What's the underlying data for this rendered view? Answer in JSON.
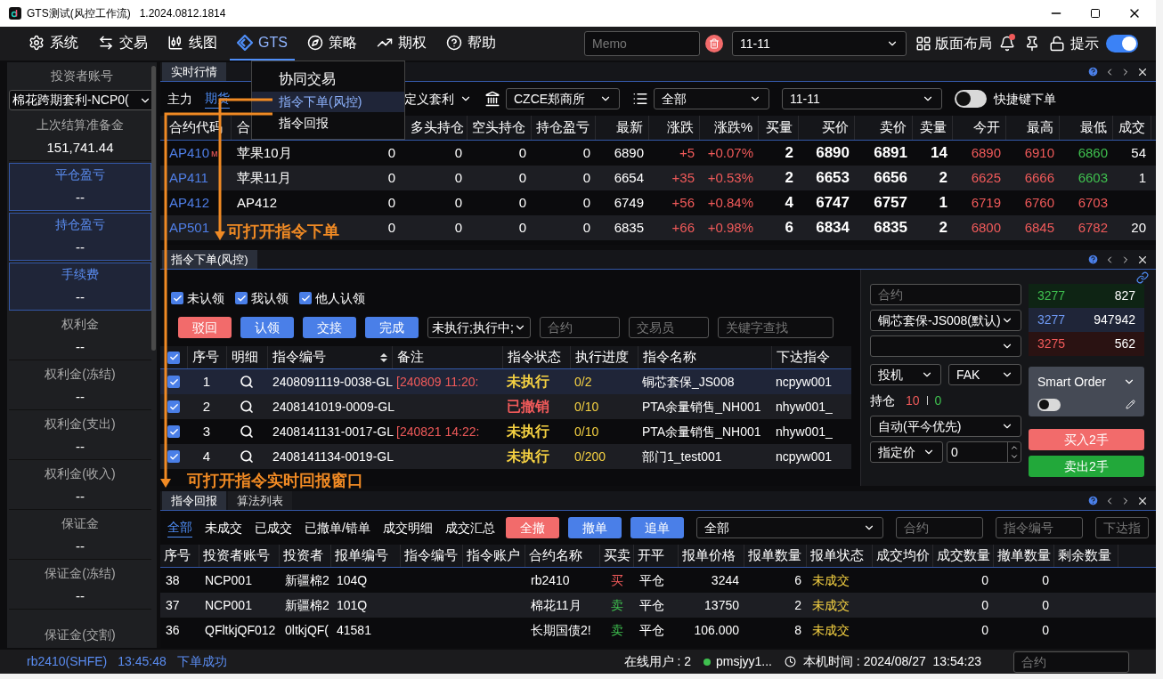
{
  "window": {
    "title": "GTS测试(风控工作流)",
    "version": "1.2024.0812.1814"
  },
  "menu": [
    {
      "label": "系统",
      "selected": false
    },
    {
      "label": "交易",
      "selected": false
    },
    {
      "label": "线图",
      "selected": false
    },
    {
      "label": "GTS",
      "selected": true
    },
    {
      "label": "策略",
      "selected": false
    },
    {
      "label": "期权",
      "selected": false
    },
    {
      "label": "帮助",
      "selected": false
    }
  ],
  "toolbar": {
    "memo_placeholder": "Memo",
    "period": "11-11",
    "layout": "版面布局",
    "hint": "提示",
    "hint_on": true
  },
  "gts_menu": [
    {
      "label": "协同交易",
      "selected": false
    },
    {
      "label": "指令下单(风控)",
      "selected": true
    },
    {
      "label": "指令回报",
      "selected": false
    }
  ],
  "annotations": [
    {
      "text": "可打开指令下单"
    },
    {
      "text": "可打开指令实时回报窗口"
    }
  ],
  "sidebar": {
    "title": "投资者账号",
    "account": "棉花跨期套利-NCP0(",
    "fields": [
      {
        "label": "上次结算准备金",
        "value": "151,741.44",
        "highlighted": false
      },
      {
        "label": "平仓盈亏",
        "value": "--",
        "highlighted": true
      },
      {
        "label": "持仓盈亏",
        "value": "--",
        "highlighted": true
      },
      {
        "label": "手续费",
        "value": "--",
        "highlighted": true
      },
      {
        "label": "权利金",
        "value": "--",
        "highlighted": false
      },
      {
        "label": "权利金(冻结)",
        "value": "--",
        "highlighted": false
      },
      {
        "label": "权利金(支出)",
        "value": "--",
        "highlighted": false
      },
      {
        "label": "权利金(收入)",
        "value": "--",
        "highlighted": false
      },
      {
        "label": "保证金",
        "value": "--",
        "highlighted": false
      },
      {
        "label": "保证金(冻结)",
        "value": "--",
        "highlighted": false
      },
      {
        "label": "保证金(交割)",
        "highlighted": false
      }
    ]
  },
  "market": {
    "tab": "实时行情",
    "filters": [
      {
        "label": "主力",
        "selected": false
      },
      {
        "label": "期货",
        "selected": true
      }
    ],
    "custom": "定义套利",
    "exchange": "CZCE郑商所",
    "category": "全部",
    "period": "11-11",
    "hotkey_label": "快捷键下单",
    "hotkey_on": false,
    "columns": [
      {
        "label": "合约代码"
      },
      {
        "label": "合"
      },
      {},
      {
        "label": "多头持仓"
      },
      {
        "label": "空头持仓"
      },
      {
        "label": "持仓盈亏"
      },
      {
        "label": "最新"
      },
      {
        "label": "涨跌"
      },
      {
        "label": "涨跌%"
      },
      {
        "label": "买量"
      },
      {
        "label": "买价"
      },
      {
        "label": "卖价"
      },
      {
        "label": "卖量"
      },
      {
        "label": "今开"
      },
      {
        "label": "最高"
      },
      {
        "label": "最低"
      },
      {
        "label": "成交"
      }
    ],
    "rows": [
      {
        "flag": "м",
        "cells": [
          "AP410",
          "苹果10月",
          "0",
          "0",
          "0",
          "0",
          "6890",
          "+5",
          "+0.07%",
          "2",
          "6890",
          "6891",
          "14",
          "6890",
          "6910",
          "6860",
          "54"
        ],
        "low_falling": true
      },
      {
        "cells": [
          "AP411",
          "苹果11月",
          "0",
          "0",
          "0",
          "0",
          "6654",
          "+35",
          "+0.53%",
          "2",
          "6653",
          "6656",
          "2",
          "6625",
          "6666",
          "6603",
          "1"
        ],
        "low_falling": true
      },
      {
        "cells": [
          "AP412",
          "AP412",
          "0",
          "0",
          "0",
          "0",
          "6749",
          "+56",
          "+0.84%",
          "4",
          "6747",
          "6757",
          "1",
          "6719",
          "6760",
          "6703",
          ""
        ],
        "low_falling": false
      },
      {
        "cells": [
          "AP501",
          "",
          "0",
          "0",
          "0",
          "0",
          "6835",
          "+66",
          "+0.98%",
          "6",
          "6834",
          "6835",
          "2",
          "6800",
          "6845",
          "6782",
          "20"
        ],
        "low_falling": false
      }
    ]
  },
  "orders": {
    "tab": "指令下单(风控)",
    "checks": [
      {
        "label": "未认领",
        "checked": true
      },
      {
        "label": "我认领",
        "checked": true
      },
      {
        "label": "他人认领",
        "checked": true
      }
    ],
    "buttons": [
      {
        "label": "驳回",
        "kind": "danger"
      },
      {
        "label": "认领",
        "kind": "primary"
      },
      {
        "label": "交接",
        "kind": "primary"
      },
      {
        "label": "完成",
        "kind": "primary"
      }
    ],
    "status_filter": "未执行;执行中;",
    "contract_placeholder": "合约",
    "trader_placeholder": "交易员",
    "keyword_placeholder": "关键字查找",
    "all_checked": true,
    "columns": [
      "序号",
      "明细",
      "指令编号",
      "备注",
      "指令状态",
      "执行进度",
      "指令名称",
      "下达指令"
    ],
    "rows": [
      {
        "checked": true,
        "selected": true,
        "no": "1",
        "id": "2408091119-0038-GL",
        "note": "[240809 11:20:",
        "status": "未执行",
        "kind": "pending",
        "progress": "0/2",
        "name": "铜芯套保_JS008",
        "issuer": "ncpyw001"
      },
      {
        "checked": true,
        "selected": false,
        "no": "2",
        "id": "2408141019-0009-GL",
        "status": "已撤销",
        "kind": "cancelled",
        "progress": "0/10",
        "name": "PTA余量销售_NH001",
        "issuer": "nhyw001_"
      },
      {
        "checked": true,
        "selected": false,
        "no": "3",
        "id": "2408141131-0017-GL",
        "note": "[240821 14:22:",
        "status": "未执行",
        "kind": "pending",
        "progress": "0/10",
        "name": "PTA余量销售_NH001",
        "issuer": "nhyw001_"
      },
      {
        "checked": true,
        "selected": false,
        "no": "4",
        "id": "2408141134-0019-GL",
        "status": "未执行",
        "kind": "pending",
        "progress": "0/200",
        "name": "部门1_test001",
        "issuer": "ncpyw001"
      }
    ],
    "form": {
      "contract_placeholder": "合约",
      "account": "铜芯套保-JS008(默认)",
      "hedge": "投机",
      "order_type": "FAK",
      "position_label": "持仓",
      "long": "10",
      "short": "0",
      "offset": "自动(平今优先)",
      "price_type": "指定价",
      "price": "0",
      "smart_order": "Smart Order",
      "smart_on": false,
      "buy": "买入2手",
      "sell": "卖出2手"
    },
    "quotes": [
      {
        "price": "3277",
        "volume": "827",
        "kind": "ask"
      },
      {
        "price": "3277",
        "volume": "947942",
        "kind": "last"
      },
      {
        "price": "3275",
        "volume": "562",
        "kind": "bid"
      }
    ]
  },
  "reports": {
    "tabs": [
      {
        "label": "指令回报",
        "selected": true
      },
      {
        "label": "算法列表",
        "selected": false
      }
    ],
    "filters": [
      {
        "label": "全部",
        "selected": true
      },
      {
        "label": "未成交",
        "selected": false
      },
      {
        "label": "已成交",
        "selected": false
      },
      {
        "label": "已撤单/错单",
        "selected": false
      },
      {
        "label": "成交明细",
        "selected": false
      },
      {
        "label": "成交汇总",
        "selected": false
      }
    ],
    "buttons": [
      {
        "label": "全撤",
        "kind": "danger"
      },
      {
        "label": "撤单",
        "kind": "primary"
      },
      {
        "label": "追单",
        "kind": "primary"
      }
    ],
    "scope": "全部",
    "contract_placeholder": "合约",
    "instruction_placeholder": "指令编号",
    "issuer_placeholder": "下达指",
    "columns": [
      "序号",
      "投资者账号",
      "投资者",
      "报单编号",
      "指令编号",
      "指令账户",
      "合约名称",
      "买卖",
      "开平",
      "报单价格",
      "报单数量",
      "报单状态",
      "成交均价",
      "成交数量",
      "撤单数量",
      "剩余数量"
    ],
    "rows": [
      {
        "cells": [
          "38",
          "NCP001",
          "新疆棉2",
          "104Q",
          "",
          "",
          "rb2410",
          "买",
          "平仓",
          "3244",
          "6",
          "未成交",
          "",
          "0",
          "0",
          ""
        ],
        "kind": "buy"
      },
      {
        "cells": [
          "37",
          "NCP001",
          "新疆棉2",
          "101Q",
          "",
          "",
          "棉花11月",
          "卖",
          "平仓",
          "13750",
          "2",
          "未成交",
          "",
          "0",
          "0",
          ""
        ],
        "kind": "sell"
      },
      {
        "cells": [
          "36",
          "QFltkjQF012",
          "0ltkjQF(",
          "41581",
          "",
          "",
          "长期国债2!",
          "卖",
          "平仓",
          "106.000",
          "8",
          "未成交",
          "",
          "0",
          "0",
          ""
        ],
        "kind": "sell"
      }
    ]
  },
  "status_bar": {
    "contract": "rb2410(SHFE)",
    "time": "13:45:48",
    "message": "下单成功",
    "online": "在线用户 : 2",
    "user": "pmsjyy1...",
    "clock": "本机时间 : 2024/08/27  13:54:23",
    "search_placeholder": "合约"
  }
}
